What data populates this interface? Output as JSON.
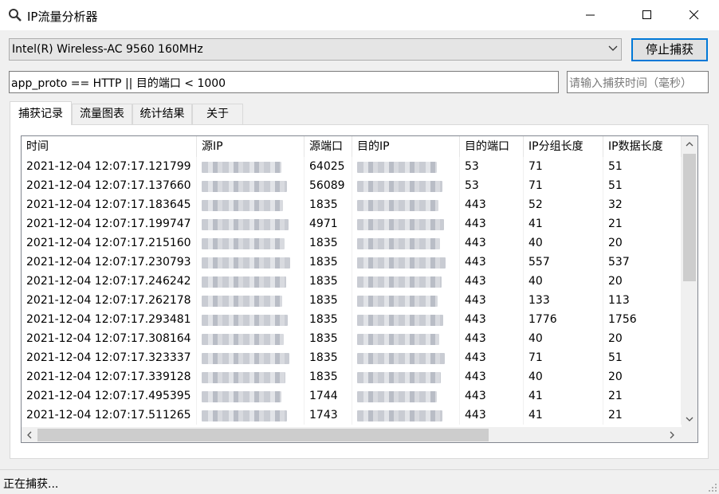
{
  "window": {
    "title": "IP流量分析器"
  },
  "device": {
    "selected": "Intel(R) Wireless-AC 9560 160MHz"
  },
  "toolbar": {
    "stop_label": "停止捕获"
  },
  "filter": {
    "value": "app_proto == HTTP || 目的端口 < 1000"
  },
  "capture_time": {
    "placeholder": "请输入捕获时间（毫秒）"
  },
  "tabs": [
    {
      "label": "捕获记录",
      "active": true
    },
    {
      "label": "流量图表",
      "active": false
    },
    {
      "label": "统计结果",
      "active": false
    },
    {
      "label": "关于",
      "active": false
    }
  ],
  "table": {
    "columns": [
      "时间",
      "源IP",
      "源端口",
      "目的IP",
      "目的端口",
      "IP分组长度",
      "IP数据长度"
    ],
    "rows": [
      [
        "2021-12-04 12:07:17.121799",
        "64025",
        "53",
        "71",
        "51"
      ],
      [
        "2021-12-04 12:07:17.137660",
        "56089",
        "53",
        "71",
        "51"
      ],
      [
        "2021-12-04 12:07:17.183645",
        "1835",
        "443",
        "52",
        "32"
      ],
      [
        "2021-12-04 12:07:17.199747",
        "4971",
        "443",
        "41",
        "21"
      ],
      [
        "2021-12-04 12:07:17.215160",
        "1835",
        "443",
        "40",
        "20"
      ],
      [
        "2021-12-04 12:07:17.230793",
        "1835",
        "443",
        "557",
        "537"
      ],
      [
        "2021-12-04 12:07:17.246242",
        "1835",
        "443",
        "40",
        "20"
      ],
      [
        "2021-12-04 12:07:17.262178",
        "1835",
        "443",
        "133",
        "113"
      ],
      [
        "2021-12-04 12:07:17.293481",
        "1835",
        "443",
        "1776",
        "1756"
      ],
      [
        "2021-12-04 12:07:17.308164",
        "1835",
        "443",
        "40",
        "20"
      ],
      [
        "2021-12-04 12:07:17.323337",
        "1835",
        "443",
        "71",
        "51"
      ],
      [
        "2021-12-04 12:07:17.339128",
        "1835",
        "443",
        "40",
        "20"
      ],
      [
        "2021-12-04 12:07:17.495395",
        "1744",
        "443",
        "41",
        "21"
      ],
      [
        "2021-12-04 12:07:17.511265",
        "1743",
        "443",
        "41",
        "21"
      ]
    ]
  },
  "status": {
    "text": "正在捕获..."
  },
  "colors": {
    "accent": "#0078d7",
    "blurred": "#c9ccd3"
  }
}
